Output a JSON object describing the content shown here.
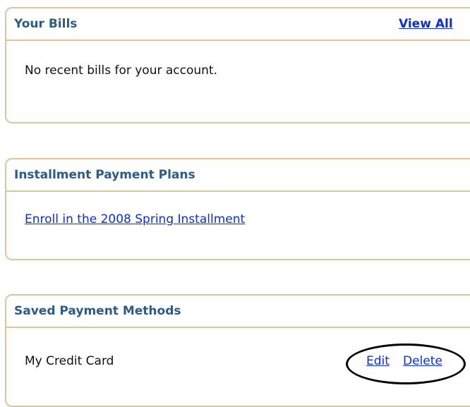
{
  "bills": {
    "title": "Your Bills",
    "view_all_label": "View All",
    "empty_message": "No recent bills for your account."
  },
  "installments": {
    "title": "Installment Payment Plans",
    "enroll_link": "Enroll in the 2008 Spring Installment"
  },
  "payment_methods": {
    "title": "Saved Payment Methods",
    "items": [
      {
        "label": "My Credit Card",
        "edit_label": "Edit",
        "delete_label": "Delete"
      }
    ]
  },
  "colors": {
    "panel_border": "#d9c79a",
    "header_text": "#2e5b86",
    "link": "#0b2fd3",
    "callout": "#000000"
  }
}
